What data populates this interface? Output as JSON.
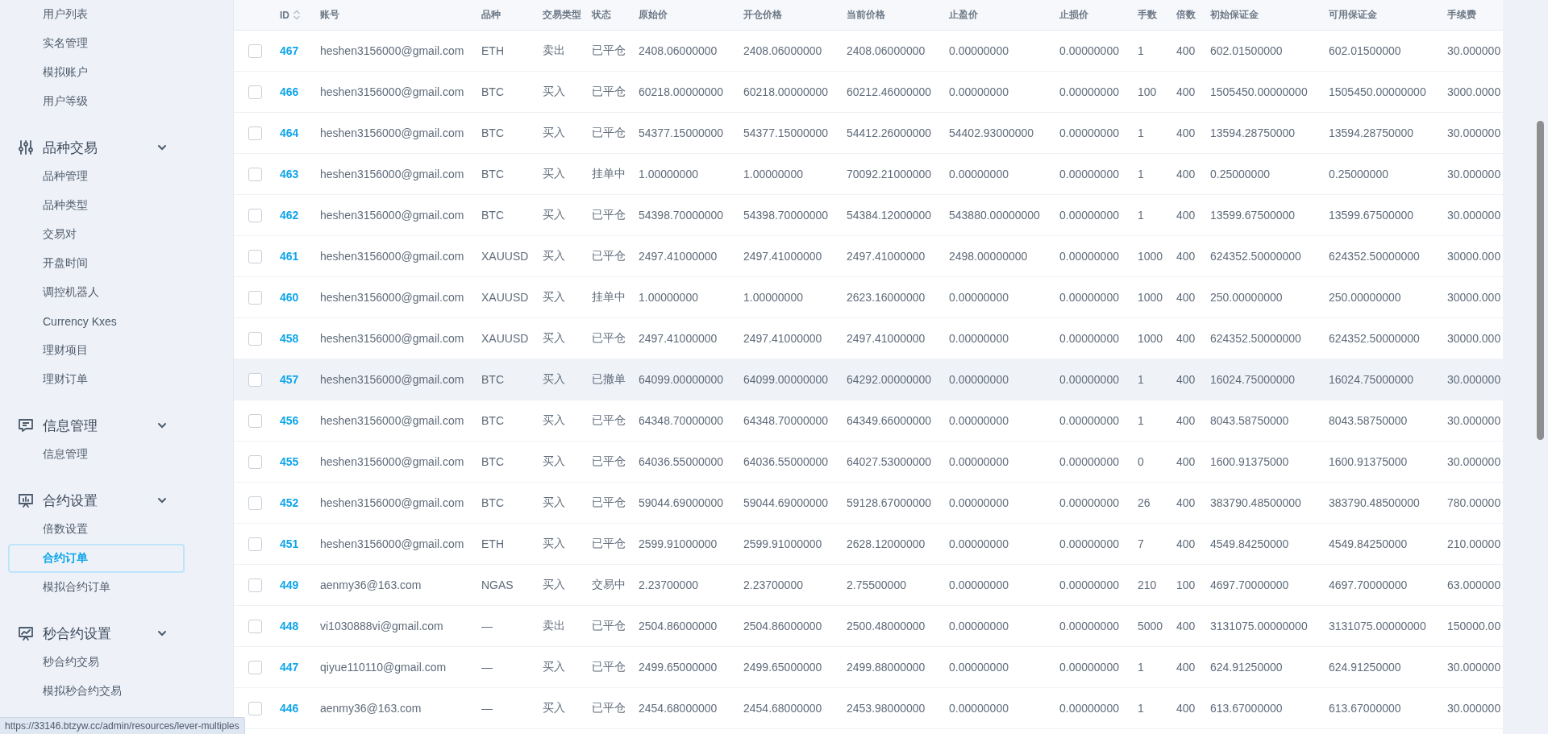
{
  "sidebar": {
    "groups": [
      {
        "items": [
          {
            "label": "用户列表",
            "selected": false
          },
          {
            "label": "实名管理",
            "selected": false
          },
          {
            "label": "模拟账户",
            "selected": false
          },
          {
            "label": "用户等级",
            "selected": false
          }
        ]
      },
      {
        "title": "品种交易",
        "expanded": true,
        "items": [
          {
            "label": "品种管理",
            "selected": false
          },
          {
            "label": "品种类型",
            "selected": false
          },
          {
            "label": "交易对",
            "selected": false
          },
          {
            "label": "开盘时间",
            "selected": false
          },
          {
            "label": "调控机器人",
            "selected": false
          },
          {
            "label": "Currency Kxes",
            "selected": false
          },
          {
            "label": "理财项目",
            "selected": false
          },
          {
            "label": "理财订单",
            "selected": false
          }
        ]
      },
      {
        "title": "信息管理",
        "expanded": true,
        "items": [
          {
            "label": "信息管理",
            "selected": false
          }
        ]
      },
      {
        "title": "合约设置",
        "expanded": true,
        "items": [
          {
            "label": "倍数设置",
            "selected": false
          },
          {
            "label": "合约订单",
            "selected": true
          },
          {
            "label": "模拟合约订单",
            "selected": false
          }
        ]
      },
      {
        "title": "秒合约设置",
        "expanded": true,
        "items": [
          {
            "label": "秒合约交易",
            "selected": false
          },
          {
            "label": "模拟秒合约交易",
            "selected": false
          }
        ]
      }
    ]
  },
  "table": {
    "columns": [
      "ID",
      "账号",
      "品种",
      "交易类型",
      "状态",
      "原始价",
      "开仓价格",
      "当前价格",
      "止盈价",
      "止损价",
      "手数",
      "倍数",
      "初始保证金",
      "可用保证金",
      "手续费"
    ],
    "rows": [
      {
        "checked": false,
        "hovered": false,
        "cells": [
          "467",
          "heshen3156000@gmail.com",
          "ETH",
          "卖出",
          "已平仓",
          "2408.06000000",
          "2408.06000000",
          "2408.06000000",
          "0.00000000",
          "0.00000000",
          "1",
          "400",
          "602.01500000",
          "602.01500000",
          "30.000000"
        ]
      },
      {
        "checked": false,
        "hovered": false,
        "cells": [
          "466",
          "heshen3156000@gmail.com",
          "BTC",
          "买入",
          "已平仓",
          "60218.00000000",
          "60218.00000000",
          "60212.46000000",
          "0.00000000",
          "0.00000000",
          "100",
          "400",
          "1505450.00000000",
          "1505450.00000000",
          "3000.0000"
        ]
      },
      {
        "checked": false,
        "hovered": false,
        "cells": [
          "464",
          "heshen3156000@gmail.com",
          "BTC",
          "买入",
          "已平仓",
          "54377.15000000",
          "54377.15000000",
          "54412.26000000",
          "54402.93000000",
          "0.00000000",
          "1",
          "400",
          "13594.28750000",
          "13594.28750000",
          "30.000000"
        ]
      },
      {
        "checked": false,
        "hovered": false,
        "cells": [
          "463",
          "heshen3156000@gmail.com",
          "BTC",
          "买入",
          "挂单中",
          "1.00000000",
          "1.00000000",
          "70092.21000000",
          "0.00000000",
          "0.00000000",
          "1",
          "400",
          "0.25000000",
          "0.25000000",
          "30.000000"
        ]
      },
      {
        "checked": false,
        "hovered": false,
        "cells": [
          "462",
          "heshen3156000@gmail.com",
          "BTC",
          "买入",
          "已平仓",
          "54398.70000000",
          "54398.70000000",
          "54384.12000000",
          "543880.00000000",
          "0.00000000",
          "1",
          "400",
          "13599.67500000",
          "13599.67500000",
          "30.000000"
        ]
      },
      {
        "checked": false,
        "hovered": false,
        "cells": [
          "461",
          "heshen3156000@gmail.com",
          "XAUUSD",
          "买入",
          "已平仓",
          "2497.41000000",
          "2497.41000000",
          "2497.41000000",
          "2498.00000000",
          "0.00000000",
          "1000",
          "400",
          "624352.50000000",
          "624352.50000000",
          "30000.000"
        ]
      },
      {
        "checked": false,
        "hovered": false,
        "cells": [
          "460",
          "heshen3156000@gmail.com",
          "XAUUSD",
          "买入",
          "挂单中",
          "1.00000000",
          "1.00000000",
          "2623.16000000",
          "0.00000000",
          "0.00000000",
          "1000",
          "400",
          "250.00000000",
          "250.00000000",
          "30000.000"
        ]
      },
      {
        "checked": false,
        "hovered": false,
        "cells": [
          "458",
          "heshen3156000@gmail.com",
          "XAUUSD",
          "买入",
          "已平仓",
          "2497.41000000",
          "2497.41000000",
          "2497.41000000",
          "0.00000000",
          "0.00000000",
          "1000",
          "400",
          "624352.50000000",
          "624352.50000000",
          "30000.000"
        ]
      },
      {
        "checked": false,
        "hovered": true,
        "cells": [
          "457",
          "heshen3156000@gmail.com",
          "BTC",
          "买入",
          "已撤单",
          "64099.00000000",
          "64099.00000000",
          "64292.00000000",
          "0.00000000",
          "0.00000000",
          "1",
          "400",
          "16024.75000000",
          "16024.75000000",
          "30.000000"
        ]
      },
      {
        "checked": false,
        "hovered": false,
        "cells": [
          "456",
          "heshen3156000@gmail.com",
          "BTC",
          "买入",
          "已平仓",
          "64348.70000000",
          "64348.70000000",
          "64349.66000000",
          "0.00000000",
          "0.00000000",
          "1",
          "400",
          "8043.58750000",
          "8043.58750000",
          "30.000000"
        ]
      },
      {
        "checked": false,
        "hovered": false,
        "cells": [
          "455",
          "heshen3156000@gmail.com",
          "BTC",
          "买入",
          "已平仓",
          "64036.55000000",
          "64036.55000000",
          "64027.53000000",
          "0.00000000",
          "0.00000000",
          "0",
          "400",
          "1600.91375000",
          "1600.91375000",
          "30.000000"
        ]
      },
      {
        "checked": false,
        "hovered": false,
        "cells": [
          "452",
          "heshen3156000@gmail.com",
          "BTC",
          "买入",
          "已平仓",
          "59044.69000000",
          "59044.69000000",
          "59128.67000000",
          "0.00000000",
          "0.00000000",
          "26",
          "400",
          "383790.48500000",
          "383790.48500000",
          "780.00000"
        ]
      },
      {
        "checked": false,
        "hovered": false,
        "cells": [
          "451",
          "heshen3156000@gmail.com",
          "ETH",
          "买入",
          "已平仓",
          "2599.91000000",
          "2599.91000000",
          "2628.12000000",
          "0.00000000",
          "0.00000000",
          "7",
          "400",
          "4549.84250000",
          "4549.84250000",
          "210.00000"
        ]
      },
      {
        "checked": false,
        "hovered": false,
        "cells": [
          "449",
          "aenmy36@163.com",
          "NGAS",
          "买入",
          "交易中",
          "2.23700000",
          "2.23700000",
          "2.75500000",
          "0.00000000",
          "0.00000000",
          "210",
          "100",
          "4697.70000000",
          "4697.70000000",
          "63.000000"
        ]
      },
      {
        "checked": false,
        "hovered": false,
        "cells": [
          "448",
          "vi1030888vi@gmail.com",
          "—",
          "卖出",
          "已平仓",
          "2504.86000000",
          "2504.86000000",
          "2500.48000000",
          "0.00000000",
          "0.00000000",
          "5000",
          "400",
          "3131075.00000000",
          "3131075.00000000",
          "150000.00"
        ]
      },
      {
        "checked": false,
        "hovered": false,
        "cells": [
          "447",
          "qiyue110110@gmail.com",
          "—",
          "买入",
          "已平仓",
          "2499.65000000",
          "2499.65000000",
          "2499.88000000",
          "0.00000000",
          "0.00000000",
          "1",
          "400",
          "624.91250000",
          "624.91250000",
          "30.000000"
        ]
      },
      {
        "checked": false,
        "hovered": false,
        "cells": [
          "446",
          "aenmy36@163.com",
          "—",
          "买入",
          "已平仓",
          "2454.68000000",
          "2454.68000000",
          "2453.98000000",
          "0.00000000",
          "0.00000000",
          "1",
          "400",
          "613.67000000",
          "613.67000000",
          "30.000000"
        ]
      }
    ]
  },
  "status_bar": {
    "url": "https://33146.btzyw.cc/admin/resources/lever-multiples"
  }
}
